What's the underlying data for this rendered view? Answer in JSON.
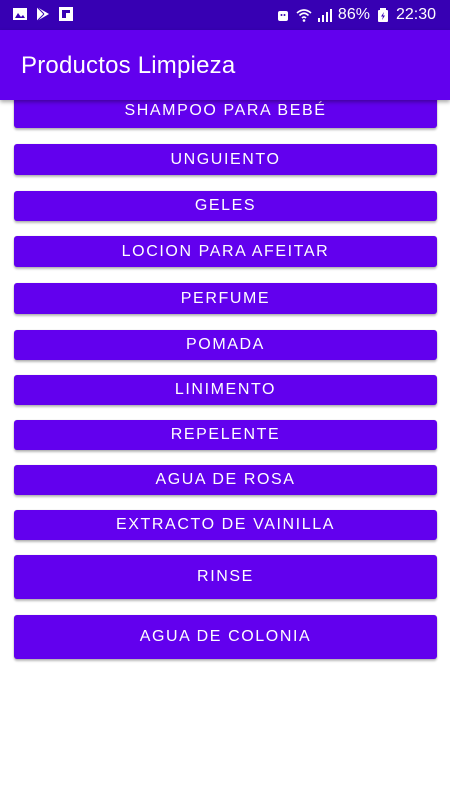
{
  "status_bar": {
    "battery": "86%",
    "time": "22:30",
    "icons": [
      "image-icon",
      "play-store-icon",
      "flipboard-icon",
      "android-debug-icon",
      "wifi-icon",
      "signal-icon",
      "battery-icon"
    ]
  },
  "app_bar": {
    "title": "Productos Limpieza"
  },
  "buttons": [
    "SHAMPOO PARA BEBÉ",
    "UNGUIENTO",
    "GELES",
    "LOCION PARA AFEITAR",
    "PERFUME",
    "POMADA",
    "LINIMENTO",
    "REPELENTE",
    "AGUA DE ROSA",
    "EXTRACTO DE VAINILLA",
    "RINSE",
    "AGUA DE COLONIA"
  ],
  "colors": {
    "primary": "#6200ee",
    "primary_dark": "#3700b3",
    "on_primary": "#ffffff"
  }
}
